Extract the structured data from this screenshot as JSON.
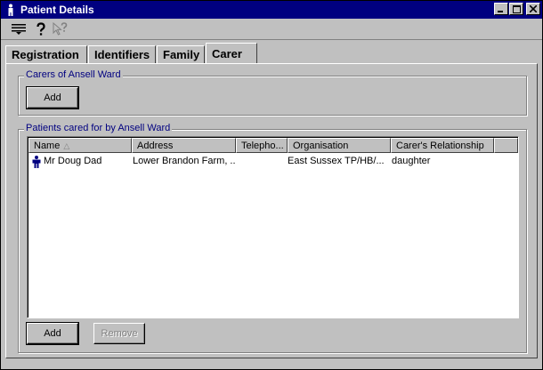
{
  "window": {
    "title": "Patient Details"
  },
  "tabs": [
    {
      "label": "Registration"
    },
    {
      "label": "Identifiers"
    },
    {
      "label": "Family"
    },
    {
      "label": "Carer"
    }
  ],
  "carers_group": {
    "label": "Carers of Ansell Ward",
    "add_label": "Add"
  },
  "patients_group": {
    "label": "Patients cared for by Ansell Ward",
    "columns": [
      "Name",
      "Address",
      "Telepho...",
      "Organisation",
      "Carer's Relationship"
    ],
    "sort_indicator": "△",
    "rows": [
      {
        "name": "Mr Doug Dad",
        "address": "Lower Brandon Farm, ...",
        "telephone": "",
        "organisation": "East Sussex TP/HB/...",
        "relationship": "daughter"
      }
    ],
    "add_label": "Add",
    "remove_label": "Remove"
  },
  "colors": {
    "titlebar": "#000080",
    "face": "#c0c0c0",
    "group_label": "#000080"
  }
}
